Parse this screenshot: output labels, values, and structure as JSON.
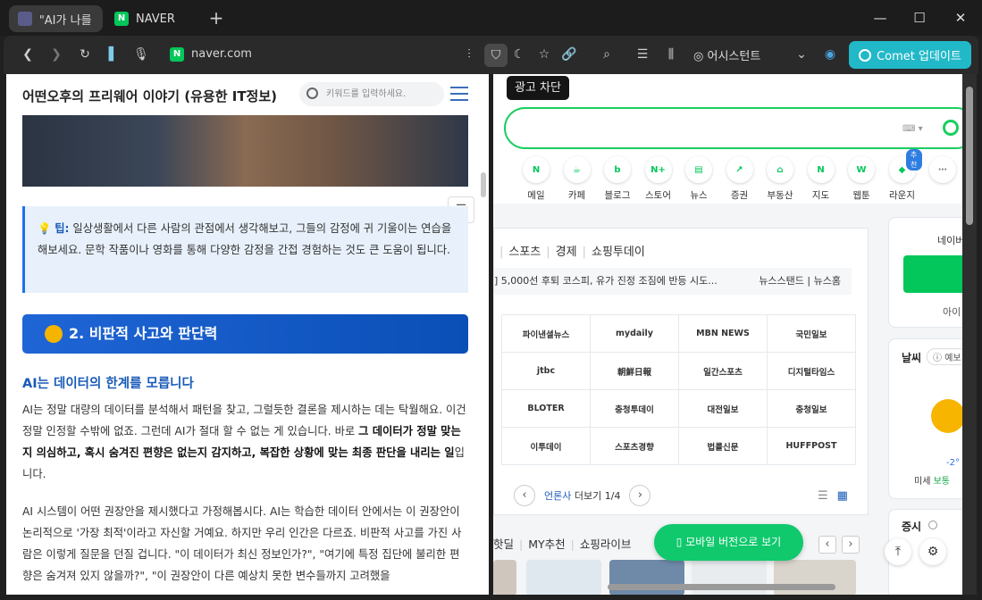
{
  "tabs": [
    {
      "title": "\"AI가 나를"
    },
    {
      "title": "NAVER",
      "icon": "N"
    }
  ],
  "window": {
    "minimize": "—",
    "maximize": "☐",
    "close": "✕"
  },
  "toolbar": {
    "url": "naver.com",
    "assistant": "어시스턴트",
    "comet_update": "Comet 업데이트",
    "url_icon": "N"
  },
  "tooltip": "광고 차단",
  "blog": {
    "title": "어떤오후의 프리웨어 이야기 (유용한 IT정보)",
    "search_placeholder": "키워드를 입력하세요.",
    "tip_label": "팁:",
    "tip_text": "일상생활에서 다른 사람의 관점에서 생각해보고, 그들의 감정에 귀 기울이는 연습을 해보세요. 문학 작품이나 영화를 통해 다양한 감정을 간접 경험하는 것도 큰 도움이 됩니다.",
    "section": "2. 비판적 사고와 판단력",
    "subheading": "AI는 데이터의 한계를 모릅니다",
    "p1_a": "AI는 정말 대량의 데이터를 분석해서 패턴을 찾고, 그럴듯한 결론을 제시하는 데는 탁월해요. 이건 정말 인정할 수밖에 없죠. 그런데 AI가 절대 할 수 없는 게 있습니다. 바로 ",
    "p1_b": "그 데이터가 정말 맞는지 의심하고, 혹시 숨겨진 편향은 없는지 감지하고, 복잡한 상황에 맞는 최종 판단을 내리는 일",
    "p1_c": "입니다.",
    "p2": "AI 시스템이 어떤 권장안을 제시했다고 가정해봅시다. AI는 학습한 데이터 안에서는 이 권장안이 논리적으로 '가장 최적'이라고 자신할 거예요. 하지만 우리 인간은 다르죠. 비판적 사고를 가진 사람은 이렇게 질문을 던질 겁니다. \"이 데이터가 최신 정보인가?\", \"여기에 특정 집단에 불리한 편향은 숨겨져 있지 않을까?\", \"이 권장안이 다른 예상치 못한 변수들까지 고려했을"
  },
  "naver": {
    "services": [
      {
        "label": "메일",
        "icon": "mail-icon",
        "glyph": "N"
      },
      {
        "label": "카페",
        "icon": "cafe-icon",
        "glyph": "☕"
      },
      {
        "label": "블로그",
        "icon": "blog-icon",
        "glyph": "b"
      },
      {
        "label": "스토어",
        "icon": "store-icon",
        "glyph": "N+"
      },
      {
        "label": "뉴스",
        "icon": "news-icon",
        "glyph": "▤"
      },
      {
        "label": "증권",
        "icon": "stock-icon",
        "glyph": "↗"
      },
      {
        "label": "부동산",
        "icon": "realestate-icon",
        "glyph": "⌂"
      },
      {
        "label": "지도",
        "icon": "map-icon",
        "glyph": "N"
      },
      {
        "label": "웹툰",
        "icon": "webtoon-icon",
        "glyph": "W"
      },
      {
        "label": "라운지",
        "icon": "lounge-icon",
        "glyph": "◆"
      }
    ],
    "lounge_badge": "추천",
    "more": "⋯",
    "news_nav": [
      "스포츠",
      "경제",
      "쇼핑투데이"
    ],
    "ticker": "] 5,000선 후퇴 코스피, 유가 진정 조짐에 반등 시도...",
    "ticker_links": [
      "뉴스스탠드",
      "뉴스홈"
    ],
    "press": [
      [
        "파이낸셜뉴스",
        "mydaily",
        "MBN NEWS",
        "국민일보"
      ],
      [
        "jtbc",
        "朝鮮日報",
        "일간스포츠",
        "디지털타임스"
      ],
      [
        "BLOTER",
        "충청투데이",
        "대전일보",
        "충청일보"
      ],
      [
        "이투데이",
        "스포츠경향",
        "법률신문",
        "HUFFPOST"
      ]
    ],
    "pager_label": "언론사",
    "pager_more": "더보기",
    "pager_count": "1/4",
    "shop_nav": [
      "핫딜",
      "MY추천",
      "쇼핑라이브"
    ],
    "mobile_btn": "모바일 버전으로 보기",
    "login_prefix": "네이버",
    "login_sub": "아이",
    "weather_label": "날씨",
    "weather_badge": "예보",
    "temp": "-2°",
    "dust_label": "미세",
    "dust_value": "보통",
    "stock_label": "증시"
  }
}
